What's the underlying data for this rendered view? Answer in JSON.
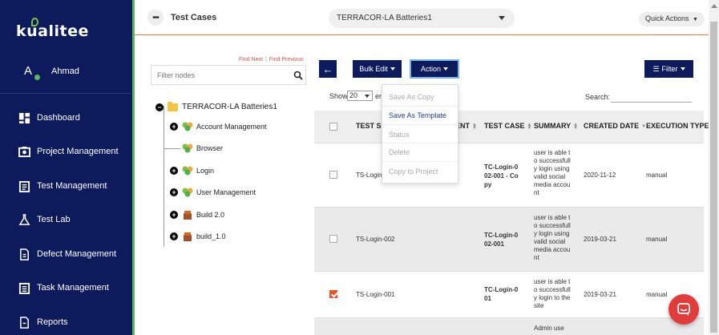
{
  "sidebar": {
    "logo": "kualitee",
    "user": {
      "initial": "A",
      "name": "Ahmad"
    },
    "items": [
      {
        "label": "Dashboard",
        "icon": "dashboard-icon"
      },
      {
        "label": "Project Management",
        "icon": "project-icon"
      },
      {
        "label": "Test Management",
        "icon": "test-management-icon"
      },
      {
        "label": "Test Lab",
        "icon": "flask-icon"
      },
      {
        "label": "Defect Management",
        "icon": "defect-icon"
      },
      {
        "label": "Task Management",
        "icon": "task-icon"
      },
      {
        "label": "Reports",
        "icon": "reports-icon"
      }
    ]
  },
  "header": {
    "title": "Test Cases",
    "project_select": "TERRACOR-LA Batteries1",
    "quick_actions": "Quick Actions"
  },
  "tree": {
    "find_next": "Find Next",
    "find_previous": "Find Previous",
    "filter_placeholder": "Filter nodes",
    "root": "TERRACOR-LA Batteries1",
    "nodes": [
      {
        "label": "Account Management",
        "expandable": true
      },
      {
        "label": "Browser",
        "expandable": false
      },
      {
        "label": "Login",
        "expandable": true
      },
      {
        "label": "User Management",
        "expandable": true
      },
      {
        "label": "Build 2.0",
        "expandable": true
      },
      {
        "label": "build_1.0",
        "expandable": true
      }
    ]
  },
  "toolbar": {
    "bulk_edit": "Bulk Edit",
    "action": "Action",
    "filter": "Filter",
    "show_label": "Show",
    "show_value": "20",
    "show_suffix": "en",
    "search_label": "Search:"
  },
  "action_menu": {
    "items": [
      "Save As Copy",
      "Save As Template",
      "Status",
      "Delete",
      "Copy to Project"
    ],
    "active_index": 1
  },
  "table": {
    "columns": [
      "TEST SC",
      "ENT",
      "TEST CASE",
      "SUMMARY",
      "CREATED DATE",
      "EXECUTION TYPE"
    ],
    "rows": [
      {
        "checked": false,
        "scenario": "TS-Login-",
        "test_case": "TC-Login-002-001 - Copy",
        "summary": "user is able to successfully login using valid social media account",
        "created": "2020-11-12",
        "exec_type": "manual"
      },
      {
        "checked": false,
        "scenario": "TS-Login-002",
        "test_case": "TC-Login-002-001",
        "summary": "user is able to successfully login using valid social media account",
        "created": "2019-03-21",
        "exec_type": "manual"
      },
      {
        "checked": true,
        "scenario": "TS-Login-001",
        "test_case": "TC-Login-001",
        "summary": "user is able to successfully login to the site",
        "created": "2019-03-21",
        "exec_type": "manual"
      },
      {
        "checked": false,
        "scenario": "",
        "test_case": "",
        "summary": "Admin use",
        "created": "",
        "exec_type": ""
      }
    ]
  },
  "colors": {
    "sidebar": "#0d1a5c",
    "accent_green": "#5cb85c",
    "accent_orange": "#e8552c",
    "chat": "#e03c3c"
  }
}
